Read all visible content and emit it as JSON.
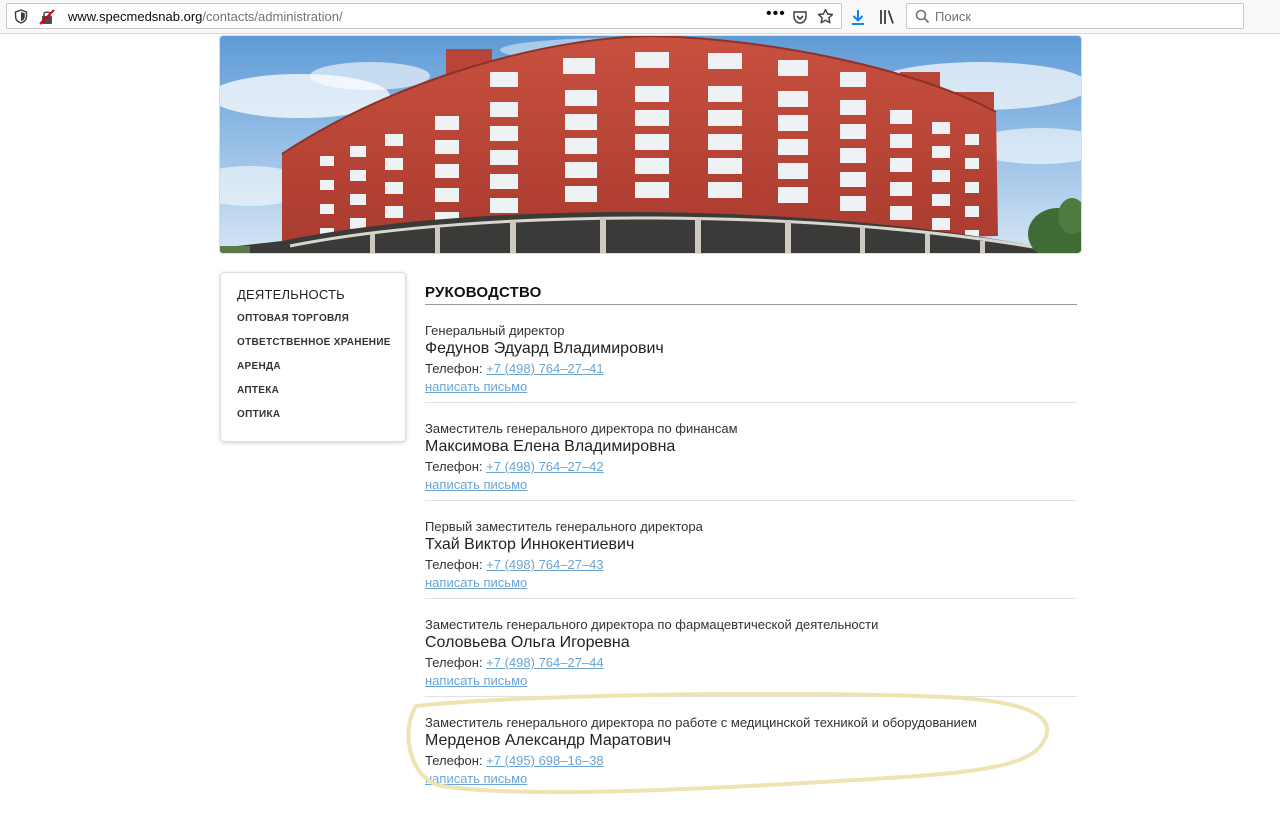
{
  "browser": {
    "url_host": "www.specmedsnab.org",
    "url_path": "/contacts/administration/",
    "page_actions_label": "•••",
    "search_placeholder": "Поиск"
  },
  "sidebar": {
    "title": "ДЕЯТЕЛЬНОСТЬ",
    "items": [
      {
        "label": "ОПТОВАЯ ТОРГОВЛЯ"
      },
      {
        "label": "ОТВЕТСТВЕННОЕ ХРАНЕНИЕ"
      },
      {
        "label": "АРЕНДА"
      },
      {
        "label": "АПТЕКА"
      },
      {
        "label": "ОПТИКА"
      }
    ]
  },
  "main": {
    "heading": "РУКОВОДСТВО",
    "phone_label": "Телефон:",
    "mail_label": "написать письмо",
    "people": [
      {
        "role": "Генеральный директор",
        "name": "Федунов Эдуард Владимирович",
        "phone": "+7 (498) 764–27–41"
      },
      {
        "role": "Заместитель генерального директора по финансам",
        "name": "Максимова Елена Владимировна",
        "phone": "+7 (498) 764–27–42"
      },
      {
        "role": "Первый заместитель генерального директора",
        "name": "Тхай Виктор Иннокентиевич",
        "phone": "+7 (498) 764–27–43"
      },
      {
        "role": "Заместитель генерального директора по фармацевтической деятельности",
        "name": "Соловьева Ольга Игоревна",
        "phone": "+7 (498) 764–27–44"
      },
      {
        "role": "Заместитель генерального директора по работе с медицинской техникой и оборудованием",
        "name": "Мерденов Александр Маратович",
        "phone": "+7 (495) 698–16–38"
      }
    ]
  },
  "colors": {
    "link": "#6aa4d3",
    "highlight_marker": "#eee3b3",
    "brick": "#c0483a"
  }
}
